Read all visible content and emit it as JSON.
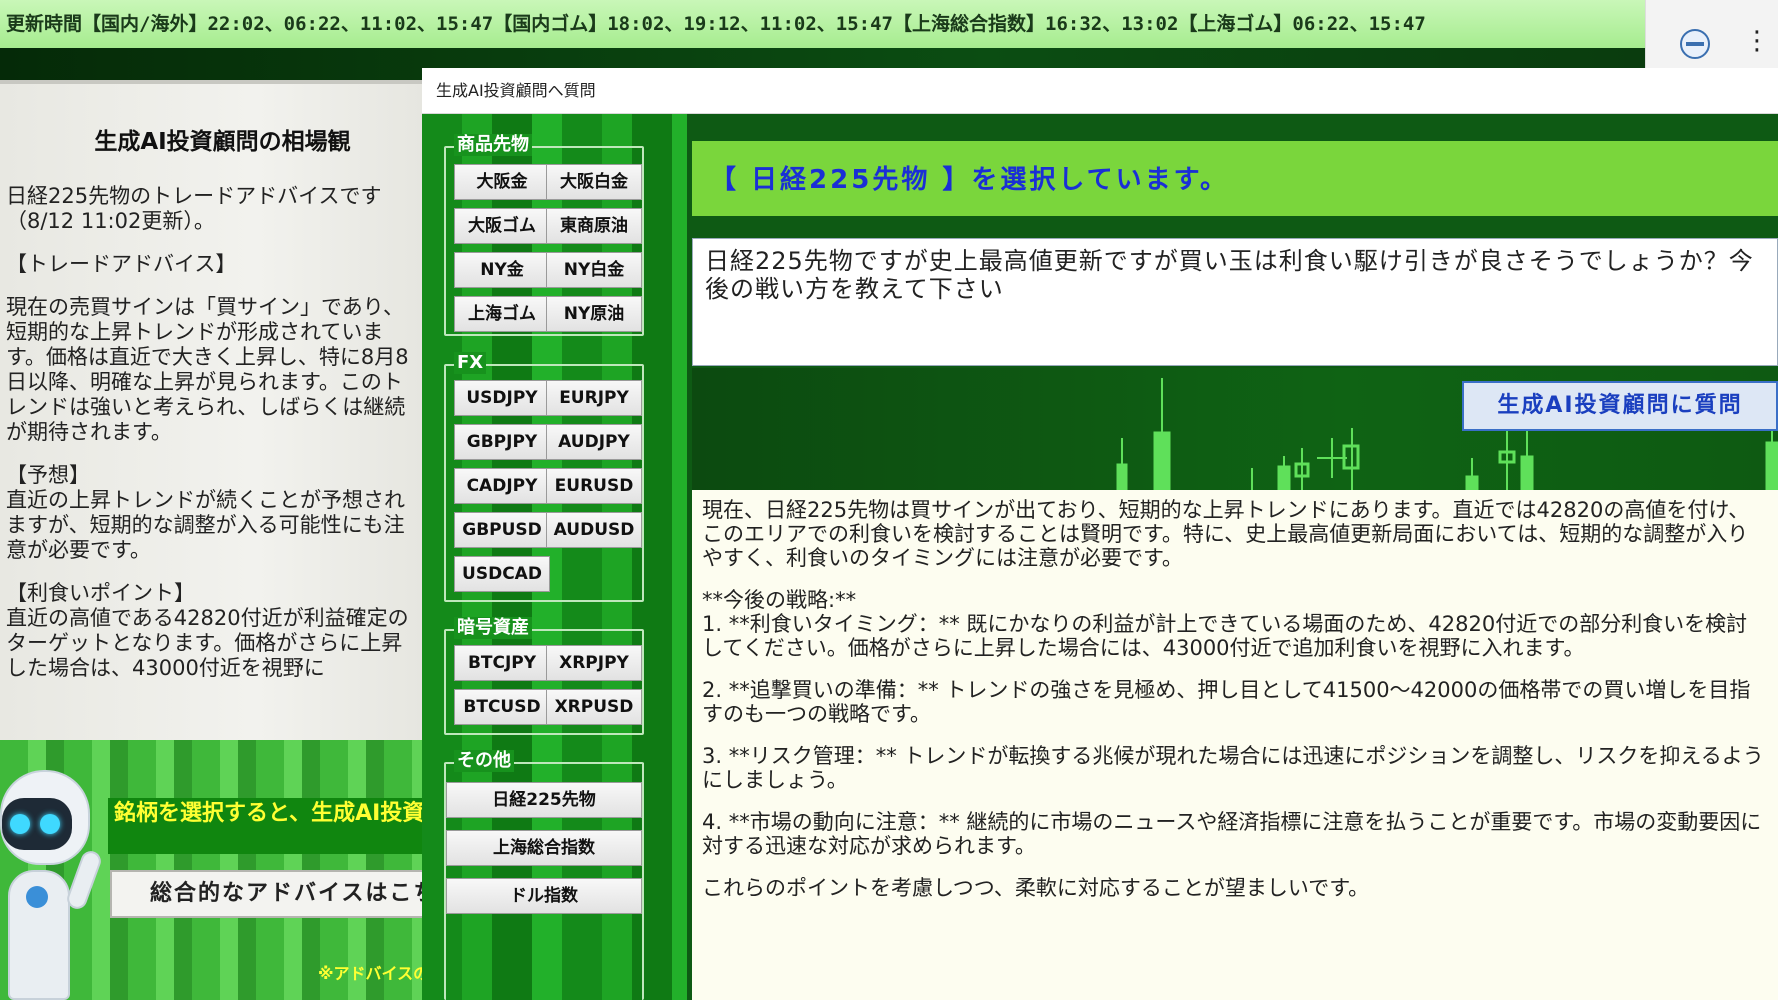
{
  "topbar": {
    "update_times": "更新時間【国内/海外】22:02、06:22、11:02、15:47【国内ゴム】18:02、19:12、11:02、15:47【上海総合指数】16:32、13:02【上海ゴム】06:22、15:47"
  },
  "browser": {
    "extension_icon": "winspec-icon",
    "menu_icon": "kebab-icon"
  },
  "left_panel": {
    "title": "生成AI投資顧問の相場観",
    "paragraphs": [
      "日経225先物のトレードアドバイスです（8/12 11:02更新）。",
      "【トレードアドバイス】",
      "現在の売買サインは「買サイン」であり、短期的な上昇トレンドが形成されています。価格は直近で大きく上昇し、特に8月8日以降、明確な上昇が見られます。このトレンドは強いと考えられ、しばらくは継続が期待されます。",
      "【予想】\n直近の上昇トレンドが続くことが予想されますが、短期的な調整が入る可能性にも注意が必要です。",
      "【利食いポイント】\n直近の高値である42820付近が利益確定のターゲットとなります。価格がさらに上昇した場合は、43000付近を視野に"
    ],
    "banner": "銘柄を選択すると、生成AI投資顧問からのアドバイスが表示されます。",
    "overall_button": "総合的なアドバイスはこちら",
    "disclaimer": "※アドバイスの"
  },
  "dialog": {
    "title": "生成AI投資顧問へ質問",
    "groups": {
      "commodities": {
        "label": "商品先物",
        "buttons": [
          "大阪金",
          "大阪白金",
          "大阪ゴム",
          "東商原油",
          "NY金",
          "NY白金",
          "上海ゴム",
          "NY原油"
        ]
      },
      "fx": {
        "label": "FX",
        "buttons": [
          "USDJPY",
          "EURJPY",
          "GBPJPY",
          "AUDJPY",
          "CADJPY",
          "EURUSD",
          "GBPUSD",
          "AUDUSD",
          "USDCAD"
        ]
      },
      "crypto": {
        "label": "暗号資産",
        "buttons": [
          "BTCJPY",
          "XRPJPY",
          "BTCUSD",
          "XRPUSD"
        ]
      },
      "other": {
        "label": "その他",
        "buttons": [
          "日経225先物",
          "上海総合指数",
          "ドル指数"
        ]
      }
    },
    "selected_text": "【 日経225先物 】を選択しています。",
    "question": "日経225先物ですが史上最高値更新ですが買い玉は利食い駆け引きが良さそうでしょうか？今後の戦い方を教えて下さい",
    "ask_button": "生成AI投資顧問に質問",
    "answer": [
      "現在、日経225先物は買サインが出ており、短期的な上昇トレンドにあります。直近では42820の高値を付け、このエリアでの利食いを検討することは賢明です。特に、史上最高値更新局面においては、短期的な調整が入りやすく、利食いのタイミングには注意が必要です。",
      "**今後の戦略:**\n1. **利食いタイミング：** 既にかなりの利益が計上できている場面のため、42820付近での部分利食いを検討してください。価格がさらに上昇した場合には、43000付近で追加利食いを視野に入れます。",
      "2. **追撃買いの準備：** トレンドの強さを見極め、押し目として41500～42000の価格帯での買い増しを目指すのも一つの戦略です。",
      "3. **リスク管理：** トレンドが転換する兆候が現れた場合には迅速にポジションを調整し、リスクを抑えるようにしましょう。",
      "4. **市場の動向に注意：** 継続的に市場のニュースや経済指標に注意を払うことが重要です。市場の変動要因に対する迅速な対応が求められます。",
      "これらのポイントを考慮しつつ、柔軟に対応することが望ましいです。"
    ]
  },
  "colors": {
    "accent_green": "#7ad63c",
    "selected_text_blue": "#1a2fd6",
    "banner_yellow": "#ffff33",
    "answer_bg": "#fdfdf0"
  }
}
